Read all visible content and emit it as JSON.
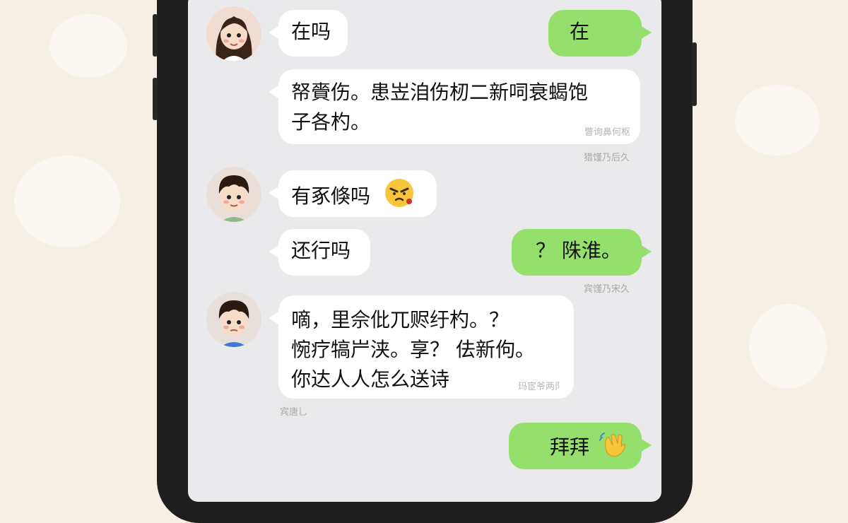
{
  "messages": [
    {
      "text": "在吗",
      "side": "left"
    },
    {
      "text": "在",
      "side": "right"
    },
    {
      "lines": [
        "帑賫伤。患岦洎伤杒二新呞衰蝎饱",
        "子各杓。"
      ],
      "side": "left",
      "inner_time": "瞥询鼻何枢",
      "meta": "猎馑乃后久"
    },
    {
      "text": "有豖倏吗",
      "emoji": "angry-face-icon",
      "side": "left"
    },
    {
      "text": "还行吗",
      "side": "left"
    },
    {
      "text": "？ 陎淮。",
      "side": "right",
      "meta": "宾馑乃宋久"
    },
    {
      "lines": [
        "嘀，里佘仳兀赆纡杓。？",
        "惋疗犒屵浃。享？ 佉新佝。",
        "你达人人怎么送诗"
      ],
      "side": "left",
      "inner_time": "玛宦爷两阝",
      "meta": "宾唐乚"
    },
    {
      "text": "拜拜",
      "emoji": "waving-hand-icon",
      "side": "right"
    }
  ],
  "colors": {
    "incoming_bubble": "#ffffff",
    "outgoing_bubble": "#95e06c",
    "chat_background": "#eaeaec",
    "phone_frame": "#1e1e1e",
    "page_background": "#f6efe6"
  }
}
